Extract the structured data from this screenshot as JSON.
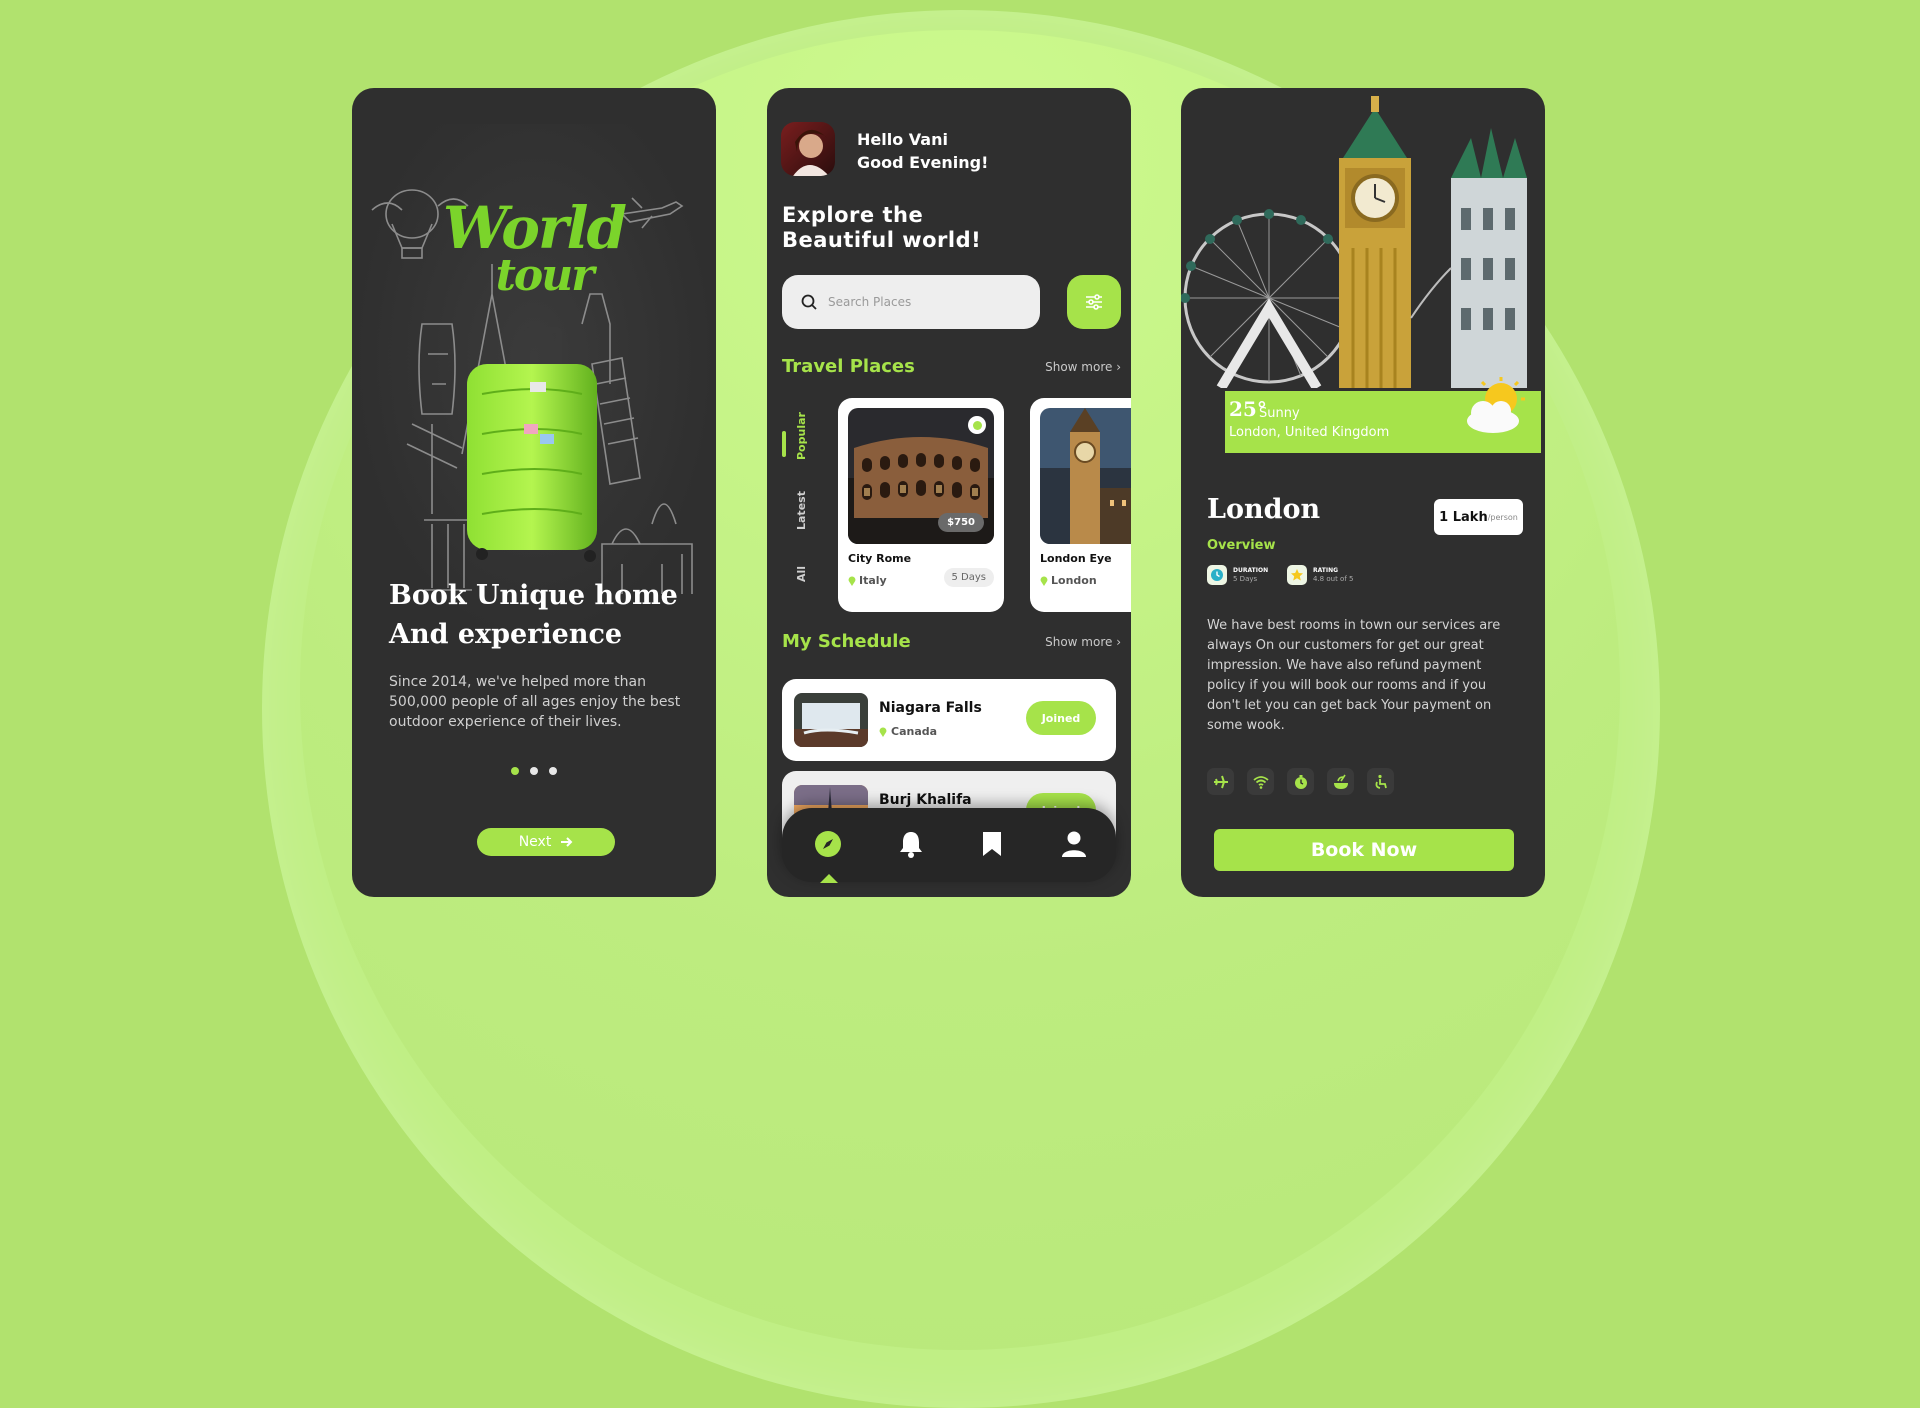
{
  "colors": {
    "background": "#b1e26e",
    "accent": "#a6e34a",
    "phone": "#2f2f2f"
  },
  "onboarding": {
    "logo_text_line1": "World",
    "logo_text_line2": "tour",
    "title_line1": "Book Unique home",
    "title_line2": "And experience",
    "description": "Since 2014, we've helped more than 500,000 people of all ages enjoy the best outdoor experience of their lives.",
    "pagination": {
      "count": 3,
      "active": 1
    },
    "next_label": "Next"
  },
  "home": {
    "greeting_line1": "Hello Vani",
    "greeting_line2": "Good Evening!",
    "headline_line1": "Explore the",
    "headline_line2": "Beautiful world!",
    "search_placeholder": "Search Places",
    "travel_title": "Travel Places",
    "show_more": "Show more ›",
    "tabs": [
      "Popular",
      "Latest",
      "All"
    ],
    "places": [
      {
        "name": "City Rome",
        "location": "Italy",
        "duration": "5 Days",
        "price": "$750"
      },
      {
        "name": "London Eye",
        "location": "London"
      }
    ],
    "schedule_title": "My Schedule",
    "schedule": [
      {
        "name": "Niagara Falls",
        "location": "Canada",
        "status": "Joined"
      },
      {
        "name": "Burj Khalifa",
        "status": "Joined"
      }
    ],
    "nav": [
      "explore-icon",
      "bell-icon",
      "bookmark-icon",
      "profile-icon"
    ]
  },
  "detail": {
    "temperature": "25°",
    "weather": "Sunny",
    "city_full": "London, United Kingdom",
    "city": "London",
    "price": "1 Lakh",
    "price_unit": "/person",
    "overview": "Overview",
    "duration_label": "DURATION",
    "duration_value": "5 Days",
    "rating_label": "RATING",
    "rating_value": "4.8 out of 5",
    "description": "We have best rooms in town our services are always On our customers for get our great impression. We have also refund payment policy if you will book our rooms and if you don't let you can get back Your payment on some wook.",
    "amenities": [
      "plane-icon",
      "wifi-icon",
      "timer-icon",
      "food-icon",
      "accessible-icon"
    ],
    "book_label": "Book Now"
  }
}
